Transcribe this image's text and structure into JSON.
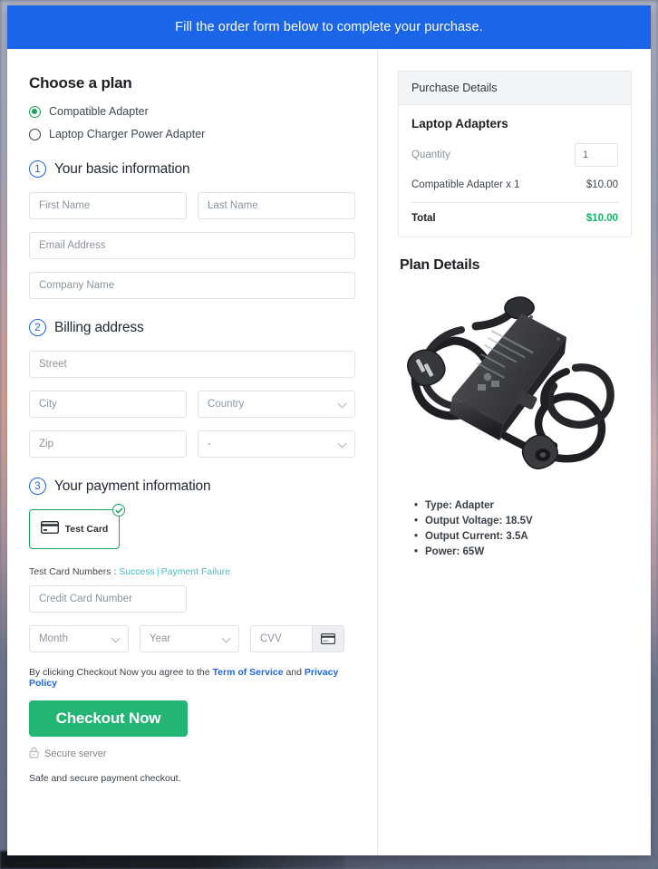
{
  "banner": {
    "message": "Fill the order form below to complete your purchase."
  },
  "plan": {
    "title": "Choose a plan",
    "options": [
      {
        "label": "Compatible Adapter",
        "selected": true
      },
      {
        "label": "Laptop Charger Power Adapter",
        "selected": false
      }
    ]
  },
  "steps": {
    "basic": {
      "number": "1",
      "title": "Your basic information"
    },
    "billing": {
      "number": "2",
      "title": "Billing address"
    },
    "payment": {
      "number": "3",
      "title": "Your payment information"
    }
  },
  "basic_fields": {
    "first_name": {
      "placeholder": "First Name",
      "value": ""
    },
    "last_name": {
      "placeholder": "Last Name",
      "value": ""
    },
    "email": {
      "placeholder": "Email Address",
      "value": ""
    },
    "company": {
      "placeholder": "Company Name",
      "value": ""
    }
  },
  "billing_fields": {
    "street": {
      "placeholder": "Street",
      "value": ""
    },
    "city": {
      "placeholder": "City",
      "value": ""
    },
    "country": {
      "selected": "Country"
    },
    "zip": {
      "placeholder": "Zip",
      "value": ""
    },
    "state": {
      "selected": "-"
    }
  },
  "payment": {
    "card_tile_label": "Test  Card",
    "card_tile_selected": true,
    "test_numbers_label": "Test Card Numbers :",
    "success_link": "Success",
    "separator": "|",
    "failure_link": "Payment Failure",
    "card_number": {
      "placeholder": "Credit Card Number",
      "value": ""
    },
    "month": {
      "selected": "Month"
    },
    "year": {
      "selected": "Year"
    },
    "cvv": {
      "placeholder": "CVV",
      "value": ""
    }
  },
  "footer": {
    "terms_prefix": "By clicking Checkout Now you agree to the",
    "terms_link": "Term of Service",
    "terms_middle": "and",
    "privacy_link": "Privacy Policy",
    "checkout_label": "Checkout Now",
    "secure_server": "Secure server",
    "safe_note": "Safe and secure payment checkout."
  },
  "purchase": {
    "header": "Purchase Details",
    "product": "Laptop Adapters",
    "quantity_label": "Quantity",
    "quantity_value": "1",
    "line_item_label": "Compatible Adapter x 1",
    "line_item_price": "$10.00",
    "total_label": "Total",
    "total_price": "$10.00"
  },
  "plan_details": {
    "title": "Plan Details",
    "image_alt": "laptop-power-adapter-image",
    "specs": [
      "Type: Adapter",
      "Output Voltage: 18.5V",
      "Output Current: 3.5A",
      "Power: 65W"
    ]
  },
  "colors": {
    "banner_blue": "#1b65e8",
    "accent_green": "#18a558",
    "checkout_green": "#22b573",
    "total_green": "#17b26a",
    "link_teal": "#3fc0c9",
    "link_blue": "#1b65e8"
  }
}
